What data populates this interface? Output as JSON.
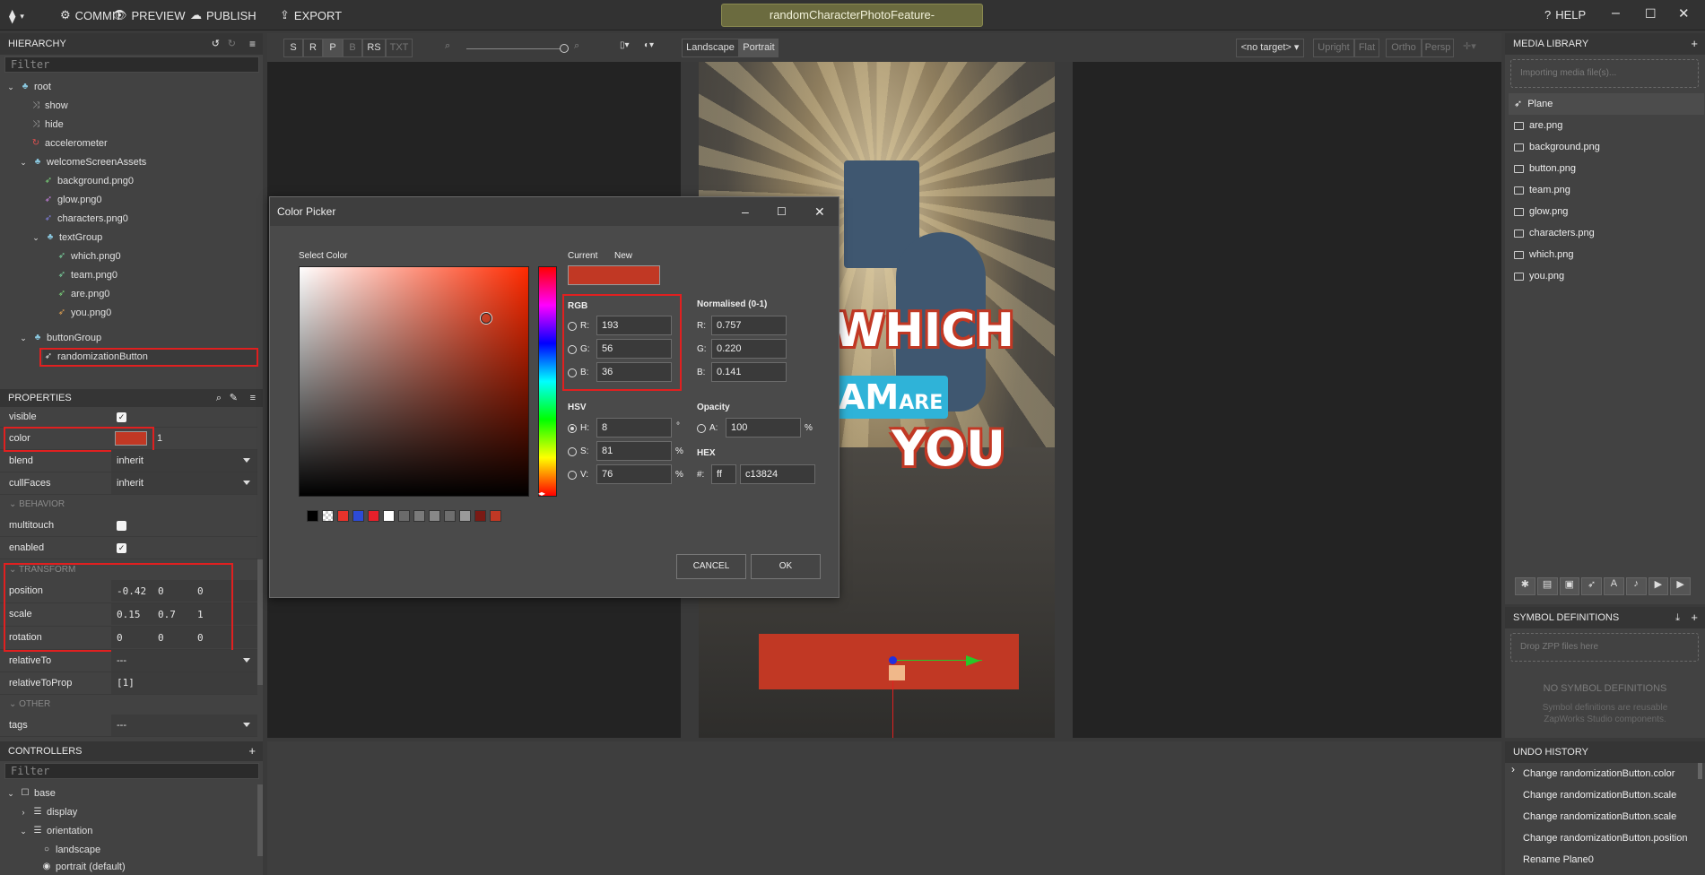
{
  "topbar": {
    "commit": "COMMIT",
    "preview": "PREVIEW",
    "publish": "PUBLISH",
    "export": "EXPORT",
    "project_title": "randomCharacterPhotoFeature-",
    "help": "HELP"
  },
  "hierarchy": {
    "title": "HIERARCHY",
    "filter_placeholder": "Filter",
    "nodes": [
      {
        "label": "root"
      },
      {
        "label": "show"
      },
      {
        "label": "hide"
      },
      {
        "label": "accelerometer"
      },
      {
        "label": "welcomeScreenAssets"
      },
      {
        "label": "background.png0"
      },
      {
        "label": "glow.png0"
      },
      {
        "label": "characters.png0"
      },
      {
        "label": "textGroup"
      },
      {
        "label": "which.png0"
      },
      {
        "label": "team.png0"
      },
      {
        "label": "are.png0"
      },
      {
        "label": "you.png0"
      },
      {
        "label": "buttonGroup"
      },
      {
        "label": "randomizationButton"
      }
    ]
  },
  "properties": {
    "title": "PROPERTIES",
    "visible_label": "visible",
    "color_label": "color",
    "color_alpha": "1",
    "color_value": "#c13824",
    "blend_label": "blend",
    "blend_value": "inherit",
    "cullfaces_label": "cullFaces",
    "cullfaces_value": "inherit",
    "behavior_section": "BEHAVIOR",
    "multitouch_label": "multitouch",
    "enabled_label": "enabled",
    "transform_section": "TRANSFORM",
    "position_label": "position",
    "position": [
      "-0.42",
      "0",
      "0"
    ],
    "scale_label": "scale",
    "scale": [
      "0.15",
      "0.7",
      "1"
    ],
    "rotation_label": "rotation",
    "rotation": [
      "0",
      "0",
      "0"
    ],
    "relativeto_label": "relativeTo",
    "relativeto_value": "---",
    "relativetoprop_label": "relativeToProp",
    "relativetoprop_value": "[1]",
    "other_section": "OTHER",
    "tags_label": "tags",
    "tags_value": "---"
  },
  "controllers": {
    "title": "CONTROLLERS",
    "filter_placeholder": "Filter",
    "items": [
      {
        "label": "base"
      },
      {
        "label": "display"
      },
      {
        "label": "orientation"
      },
      {
        "label": "landscape"
      },
      {
        "label": "portrait (default)"
      }
    ]
  },
  "viewport_toolbar": {
    "buttons": [
      "S",
      "R",
      "P",
      "B",
      "RS",
      "TXT"
    ],
    "landscape": "Landscape",
    "portrait": "Portrait",
    "target": "<no target>",
    "upright": "Upright",
    "flat": "Flat",
    "ortho": "Ortho",
    "persp": "Persp"
  },
  "color_picker": {
    "title": "Color Picker",
    "select_color": "Select Color",
    "current": "Current",
    "new": "New",
    "current_color": "#c13824",
    "rgb_label": "RGB",
    "r_label": "R:",
    "g_label": "G:",
    "b_label": "B:",
    "r": "193",
    "g": "56",
    "b": "36",
    "normalised_label": "Normalised (0-1)",
    "nr": "0.757",
    "ng": "0.220",
    "nb": "0.141",
    "hsv_label": "HSV",
    "h_label": "H:",
    "s_label": "S:",
    "v_label": "V:",
    "h": "8",
    "s": "81",
    "v": "76",
    "deg": "°",
    "pct": "%",
    "opacity_label": "Opacity",
    "a_label": "A:",
    "a": "100",
    "hex_label": "HEX",
    "hex_prefix_label": "#:",
    "hex_alpha": "ff",
    "hex": "c13824",
    "cancel": "CANCEL",
    "ok": "OK",
    "swatches": [
      "#000000",
      "checker",
      "#e8332b",
      "#2d4bd6",
      "#e6202a",
      "#ffffff",
      "#6b6b6b",
      "#7a7a7a",
      "#888888",
      "#6e6e6e",
      "#9a9a9a",
      "#7a1a14",
      "#c13824"
    ]
  },
  "scene": {
    "line1": "WHICH",
    "line2_big": "AM",
    "line2_small": "ARE",
    "line3": "YOU"
  },
  "media_library": {
    "title": "MEDIA LIBRARY",
    "import_placeholder": "Importing media file(s)...",
    "items": [
      {
        "label": "Plane"
      },
      {
        "label": "are.png"
      },
      {
        "label": "background.png"
      },
      {
        "label": "button.png"
      },
      {
        "label": "team.png"
      },
      {
        "label": "glow.png"
      },
      {
        "label": "characters.png"
      },
      {
        "label": "which.png"
      },
      {
        "label": "you.png"
      }
    ]
  },
  "symbols": {
    "title": "SYMBOL DEFINITIONS",
    "drop_placeholder": "Drop ZPP files here",
    "empty": "NO SYMBOL DEFINITIONS",
    "hint": "Symbol definitions are reusable ZapWorks Studio components."
  },
  "undo": {
    "title": "UNDO HISTORY",
    "items": [
      "Change randomizationButton.color",
      "Change randomizationButton.scale",
      "Change randomizationButton.scale",
      "Change randomizationButton.position",
      "Rename Plane0"
    ]
  }
}
